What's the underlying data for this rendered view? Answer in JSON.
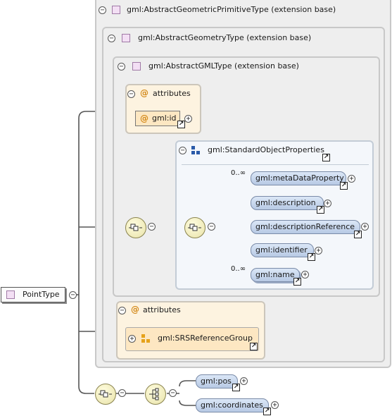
{
  "boxes": {
    "primitive": "gml:AbstractGeometricPrimitiveType (extension base)",
    "geometry": "gml:AbstractGeometryType (extension base)",
    "gmltype": "gml:AbstractGMLType (extension base)"
  },
  "attributes_top": {
    "title": "attributes",
    "id_attr": "gml:id"
  },
  "standard_props": {
    "title": "gml:StandardObjectProperties",
    "elements": [
      {
        "label": "gml:metaDataProperty",
        "cardinality": "0..∞"
      },
      {
        "label": "gml:description",
        "cardinality": ""
      },
      {
        "label": "gml:descriptionReference",
        "cardinality": ""
      },
      {
        "label": "gml:identifier",
        "cardinality": ""
      },
      {
        "label": "gml:name",
        "cardinality": "0..∞"
      }
    ]
  },
  "attributes_bottom": {
    "title": "attributes",
    "group": "gml:SRSReferenceGroup"
  },
  "root": {
    "label": "PointType"
  },
  "choice": {
    "items": [
      "gml:pos",
      "gml:coordinates"
    ]
  },
  "symbols": {
    "collapse": "⊖",
    "expand": "⊕",
    "minus": "−",
    "plus": "+",
    "at": "@",
    "link": "↗"
  },
  "colors": {
    "element_fill": "#c8d8ee",
    "attribute_fill": "#fdf3e0",
    "complex_type_square": "#f3dff4",
    "group_icon": "#e6a21a",
    "sequence_icon": "#2a5aa8"
  },
  "icons": [
    "collapse-toggle",
    "expand-toggle",
    "complex-type-square",
    "attribute-at-icon",
    "link-arrow-icon",
    "sequence-compositor-icon",
    "choice-compositor-icon",
    "attribute-group-icon",
    "element-group-icon"
  ]
}
